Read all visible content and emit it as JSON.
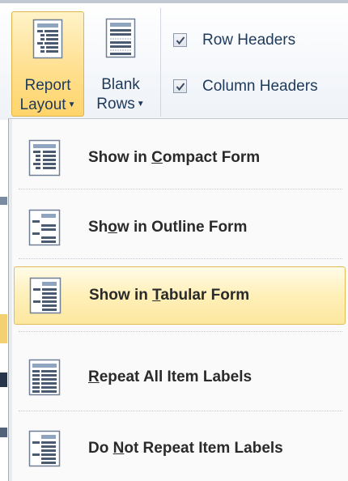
{
  "ribbon": {
    "report_layout": {
      "line1": "Report",
      "line2": "Layout"
    },
    "blank_rows": {
      "line1": "Blank",
      "line2": "Rows"
    },
    "row_headers": {
      "label": "Row Headers",
      "checked": true
    },
    "column_headers": {
      "label": "Column Headers",
      "checked": true
    }
  },
  "menu": {
    "items": [
      {
        "pre": "Show in ",
        "key": "C",
        "post": "ompact Form",
        "icon": "compact-form-icon",
        "highlighted": false
      },
      {
        "pre": "Sh",
        "key": "o",
        "post": "w in Outline Form",
        "icon": "outline-form-icon",
        "highlighted": false
      },
      {
        "pre": "Show in ",
        "key": "T",
        "post": "abular Form",
        "icon": "tabular-form-icon",
        "highlighted": true
      },
      {
        "pre": "",
        "key": "R",
        "post": "epeat All Item Labels",
        "icon": "repeat-labels-icon",
        "highlighted": false
      },
      {
        "pre": "Do ",
        "key": "N",
        "post": "ot Repeat Item Labels",
        "icon": "no-repeat-labels-icon",
        "highlighted": false
      }
    ]
  },
  "colors": {
    "ribbon_text": "#1e395b",
    "highlight_border": "#e3bc59",
    "highlight_fill": "#fff0b8",
    "menu_text": "#2a2a2a"
  }
}
